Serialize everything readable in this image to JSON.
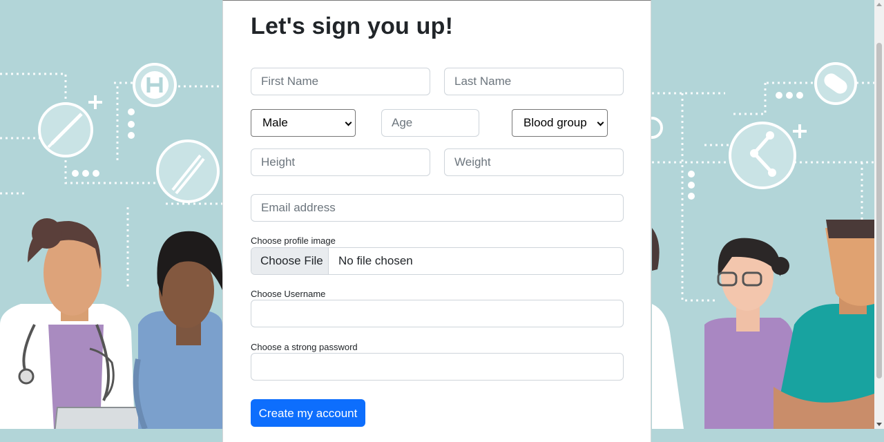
{
  "form": {
    "title": "Let's sign you up!",
    "first_name_placeholder": "First Name",
    "last_name_placeholder": "Last Name",
    "gender_selected": "Male",
    "age_placeholder": "Age",
    "blood_group_selected": "Blood group",
    "height_placeholder": "Height",
    "weight_placeholder": "Weight",
    "email_placeholder": "Email address",
    "profile_image_label": "Choose profile image",
    "choose_file_button": "Choose File",
    "no_file_text": "No file chosen",
    "username_label": "Choose Username",
    "password_label": "Choose a strong password",
    "submit_label": "Create my account"
  },
  "colors": {
    "background": "#b2d5d8",
    "primary": "#0d6efd",
    "illustration_stroke": "#ffffff"
  },
  "illustration": {
    "icons": [
      "syringe-icon",
      "hospital-icon",
      "dna-icon",
      "pill-icon",
      "share-icon",
      "plus-icon"
    ],
    "people": [
      "doctor-woman",
      "nurse",
      "woman-glasses",
      "man-scrubs"
    ]
  }
}
